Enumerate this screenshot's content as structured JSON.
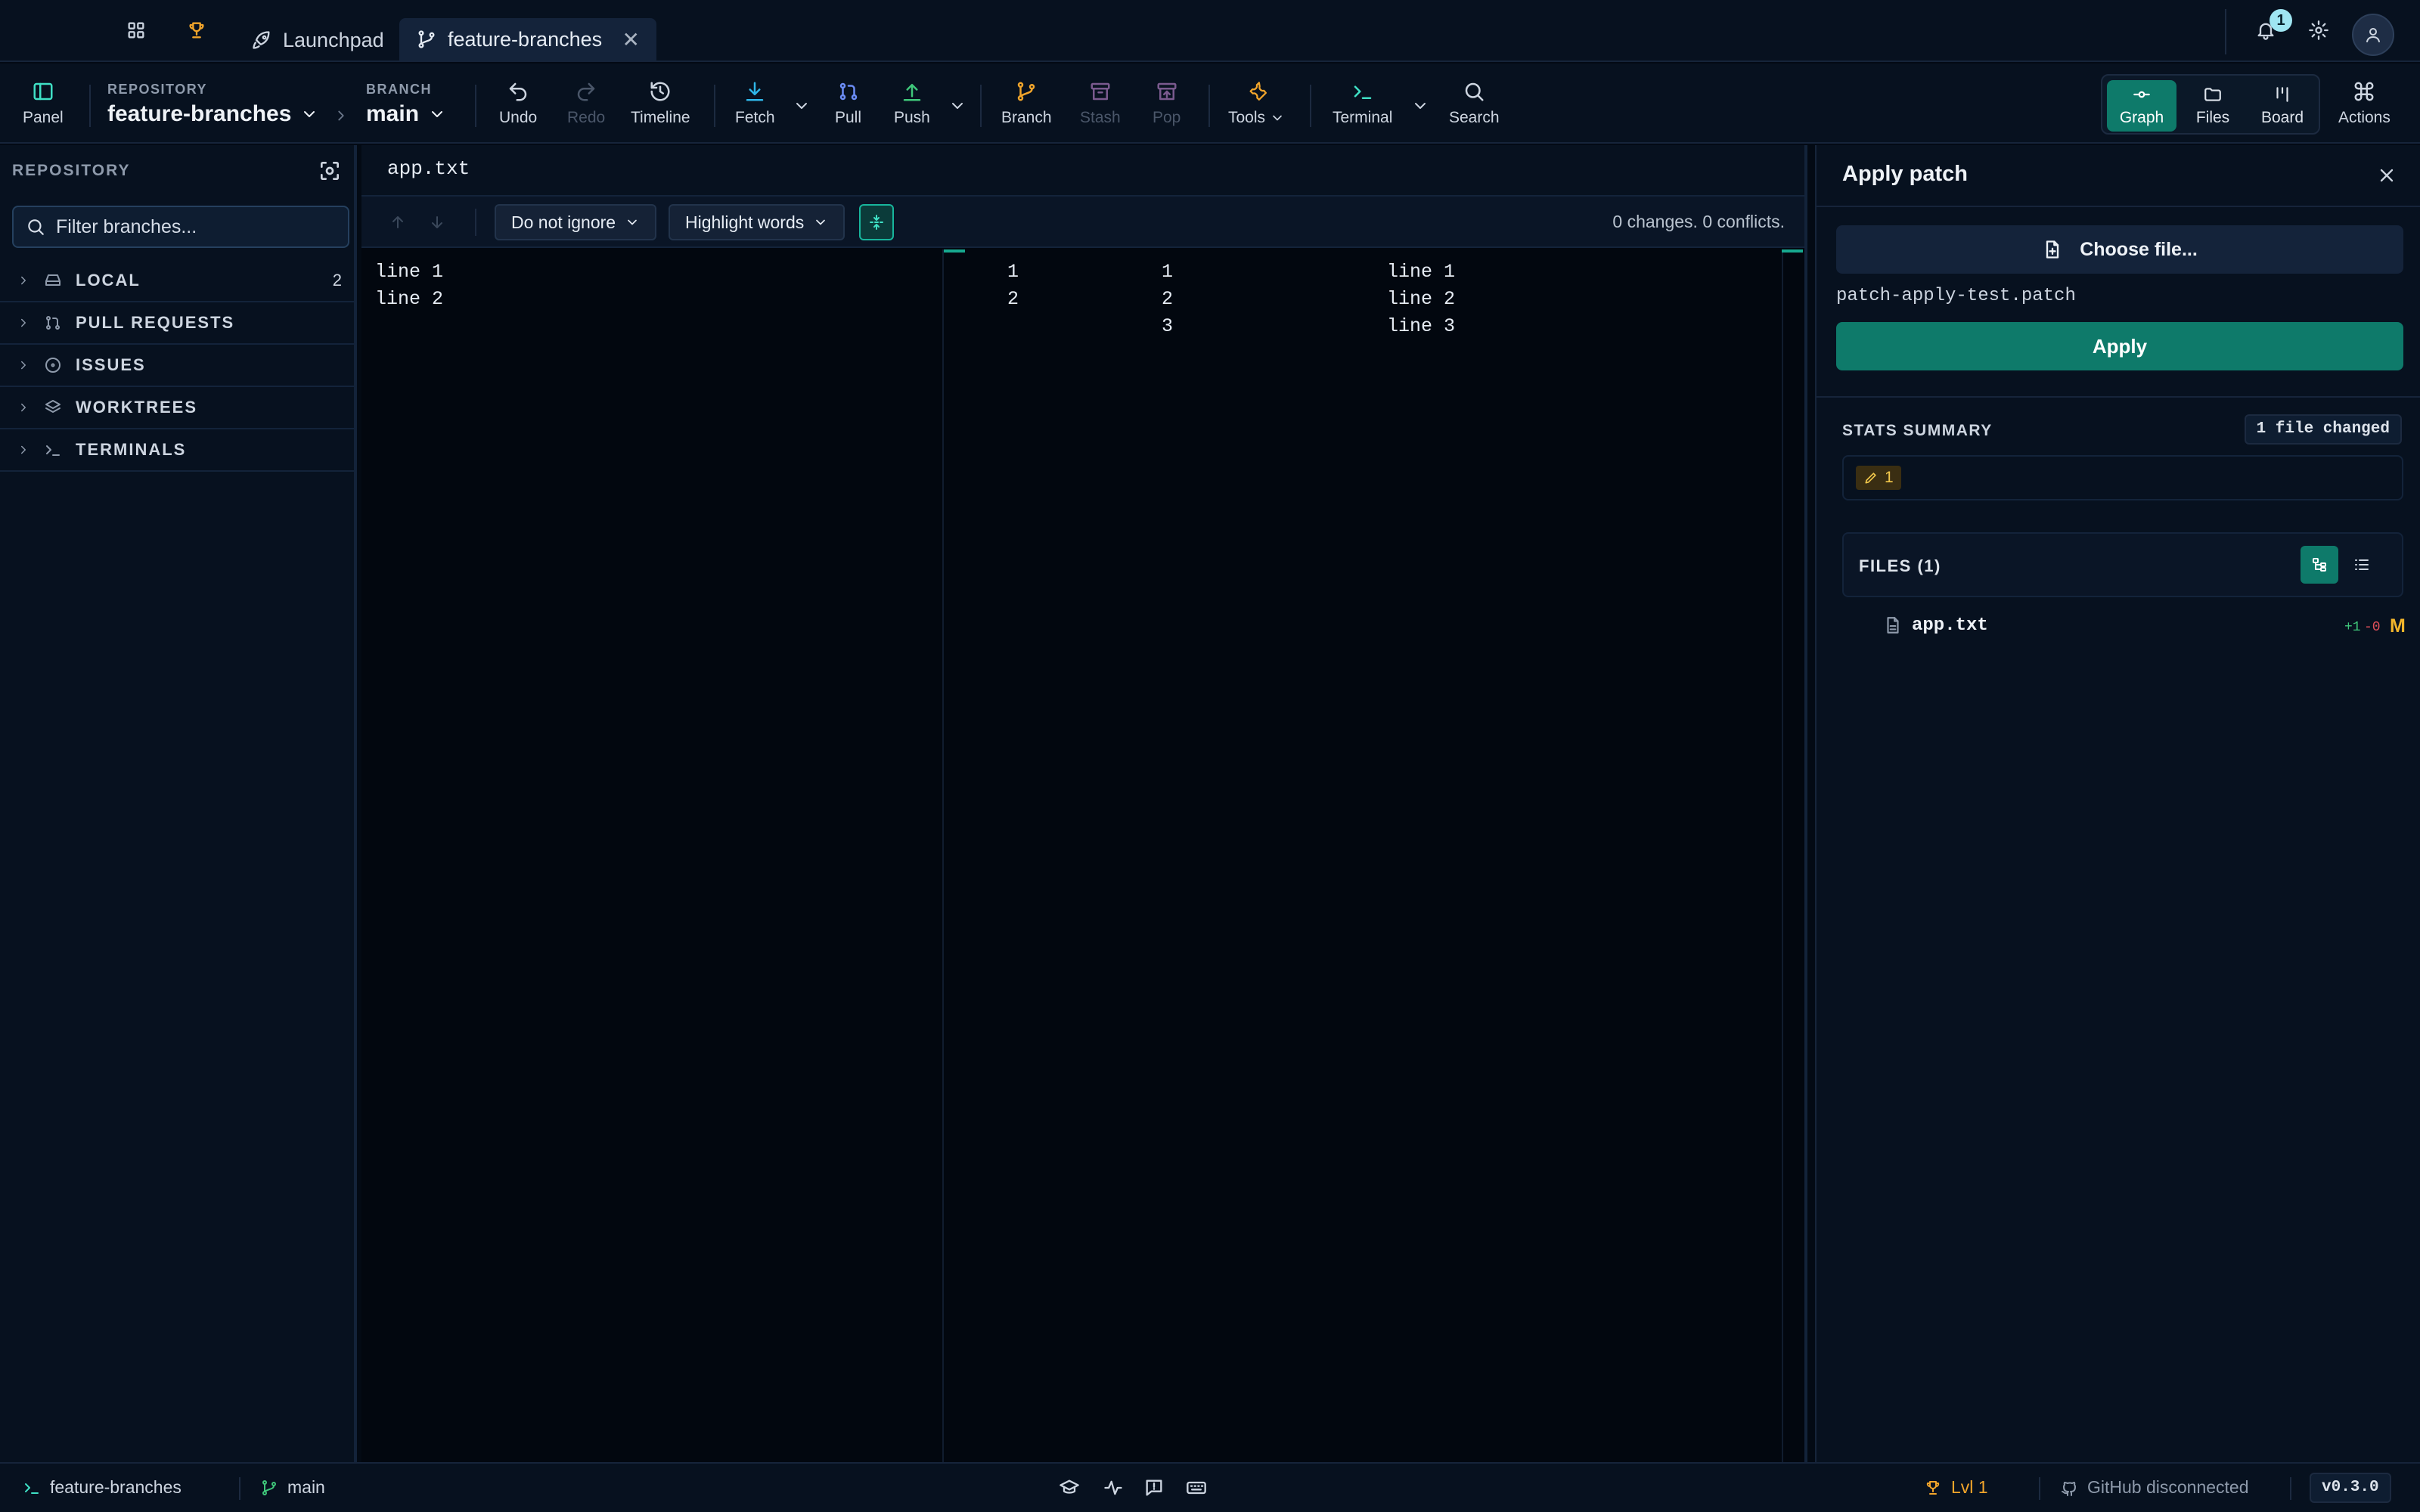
{
  "tabs": {
    "launchpad_label": "Launchpad",
    "active_label": "feature-branches",
    "notification_count": "1"
  },
  "toolbar": {
    "panel": "Panel",
    "repo_caption": "REPOSITORY",
    "repo_name": "feature-branches",
    "branch_caption": "BRANCH",
    "branch_name": "main",
    "undo": "Undo",
    "redo": "Redo",
    "timeline": "Timeline",
    "fetch": "Fetch",
    "pull": "Pull",
    "push": "Push",
    "branch": "Branch",
    "stash": "Stash",
    "pop": "Pop",
    "tools": "Tools",
    "terminal": "Terminal",
    "search": "Search",
    "views": [
      "Graph",
      "Files",
      "Board"
    ],
    "actions": "Actions"
  },
  "sidebar": {
    "heading": "REPOSITORY",
    "filter_placeholder": "Filter branches...",
    "sections": [
      {
        "label": "LOCAL",
        "count": "2",
        "icon": "drive-icon"
      },
      {
        "label": "PULL REQUESTS",
        "count": "",
        "icon": "pull-request-icon"
      },
      {
        "label": "ISSUES",
        "count": "",
        "icon": "issue-icon"
      },
      {
        "label": "WORKTREES",
        "count": "",
        "icon": "layers-icon"
      },
      {
        "label": "TERMINALS",
        "count": "",
        "icon": "terminal-icon"
      }
    ]
  },
  "diff": {
    "file": "app.txt",
    "ignore_option": "Do not ignore",
    "highlight_option": "Highlight words",
    "summary": "0 changes. 0 conflicts.",
    "left_lines": [
      "line 1",
      "line 2"
    ],
    "left_numbers": [
      "1",
      "2"
    ],
    "right_numbers": [
      "1",
      "2",
      "3"
    ],
    "right_lines": [
      "line 1",
      "line 2",
      "line 3"
    ]
  },
  "patch_panel": {
    "title": "Apply patch",
    "choose_label": "Choose file...",
    "patch_file": "patch-apply-test.patch",
    "apply_label": "Apply",
    "stats_label": "STATS SUMMARY",
    "stats_count": "1 file changed",
    "modified_count": "1",
    "files_label": "FILES (1)",
    "file_name": "app.txt",
    "additions": "+1",
    "deletions": "-0",
    "file_status": "M"
  },
  "statusbar": {
    "repo": "feature-branches",
    "branch": "main",
    "level": "Lvl 1",
    "github": "GitHub disconnected",
    "version": "v0.3.0"
  },
  "colors": {
    "accent": "#0e7a6a",
    "background": "#030a14",
    "modified": "#f2b52b"
  }
}
